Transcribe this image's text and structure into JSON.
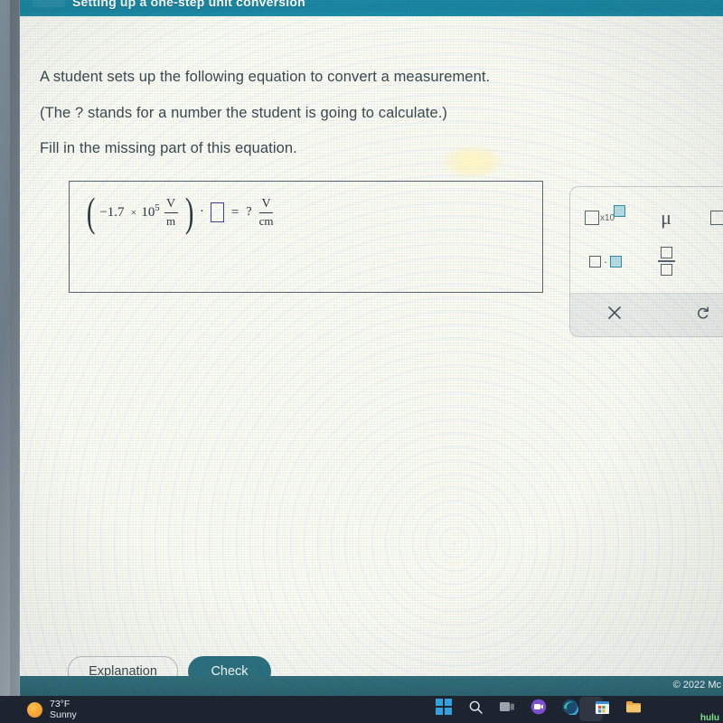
{
  "header": {
    "title": "Setting up a one-step unit conversion",
    "collapse_icon": "chevron-down-icon",
    "bar_color": "#1a86a3"
  },
  "prompt": {
    "line1": "A student sets up the following equation to convert a measurement.",
    "line2": "(The ? stands for a number the student is going to calculate.)",
    "line3": "Fill in the missing part of this equation."
  },
  "equation": {
    "open_paren": "(",
    "coefficient": "−1.7",
    "times": "×",
    "base": "10",
    "exponent": "5",
    "left_unit_numerator": "V",
    "left_unit_denominator": "m",
    "close_paren": ")",
    "multiply_dot": "·",
    "answer_placeholder": "",
    "equals": "=",
    "question_mark": "?",
    "right_unit_numerator": "V",
    "right_unit_denominator": "cm",
    "input_border_color": "#3b3fa8"
  },
  "keypad": {
    "buttons": [
      {
        "name": "scientific-notation-button",
        "label": "□x10□",
        "x10_text": "x10"
      },
      {
        "name": "micro-prefix-button",
        "label": "μ"
      },
      {
        "name": "superscript-button",
        "label": "□□"
      },
      {
        "name": "multiplication-button",
        "label": "□·□",
        "dot": "·"
      },
      {
        "name": "fraction-button",
        "label": "□/□"
      }
    ],
    "footer": {
      "clear_label": "×",
      "undo_label": "↺"
    },
    "accent_color": "#2f8fa3"
  },
  "actions": {
    "explanation_label": "Explanation",
    "check_label": "Check",
    "check_color": "#2b7282"
  },
  "footer": {
    "copyright": "© 2022 Mc"
  },
  "taskbar": {
    "weather": {
      "temperature": "73°F",
      "condition": "Sunny",
      "icon": "sun-icon"
    },
    "icons": [
      "windows-start-icon",
      "search-icon",
      "task-view-icon",
      "teams-camera-icon",
      "edge-browser-icon",
      "microsoft-store-icon",
      "file-explorer-icon"
    ],
    "hulu_label": "hulu"
  }
}
